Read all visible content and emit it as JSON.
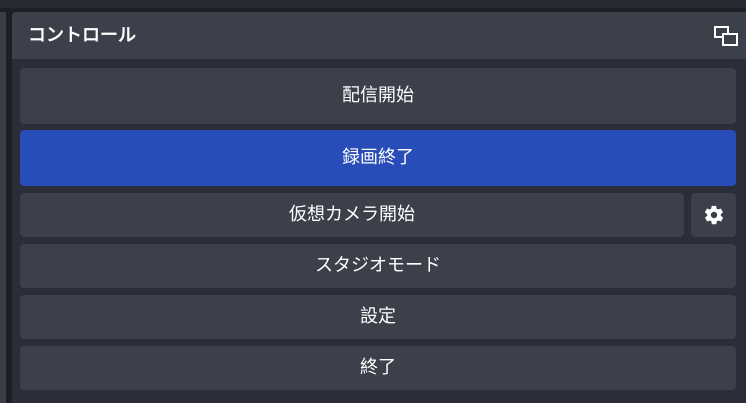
{
  "dock": {
    "title": "コントロール",
    "float_icon": "float-dock-icon"
  },
  "controls": {
    "start_streaming": "配信開始",
    "stop_recording": "録画終了",
    "start_virtual_camera": "仮想カメラ開始",
    "virtual_camera_settings_icon": "gear-icon",
    "studio_mode": "スタジオモード",
    "settings": "設定",
    "exit": "終了"
  },
  "colors": {
    "panel_background": "#2b2e38",
    "button_background": "#3c404b",
    "active_button": "#284cb8"
  }
}
